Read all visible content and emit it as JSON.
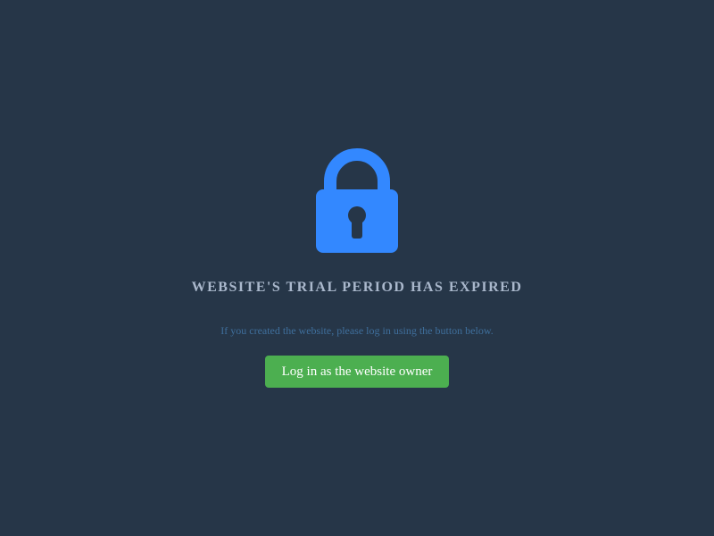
{
  "lock_icon": {
    "name": "padlock-icon",
    "color": "#3388ff",
    "keyhole_color": "#263648"
  },
  "message": {
    "title": "WEBSITE'S TRIAL PERIOD HAS EXPIRED",
    "subtitle": "If you created the website, please log in using the button below."
  },
  "actions": {
    "owner_login_label": "Log in as the website owner"
  },
  "colors": {
    "background": "#263648",
    "title_text": "#aab8cc",
    "subtitle_text": "#3f6f9c",
    "button_background": "#4caf50",
    "button_text": "#ffffff"
  }
}
